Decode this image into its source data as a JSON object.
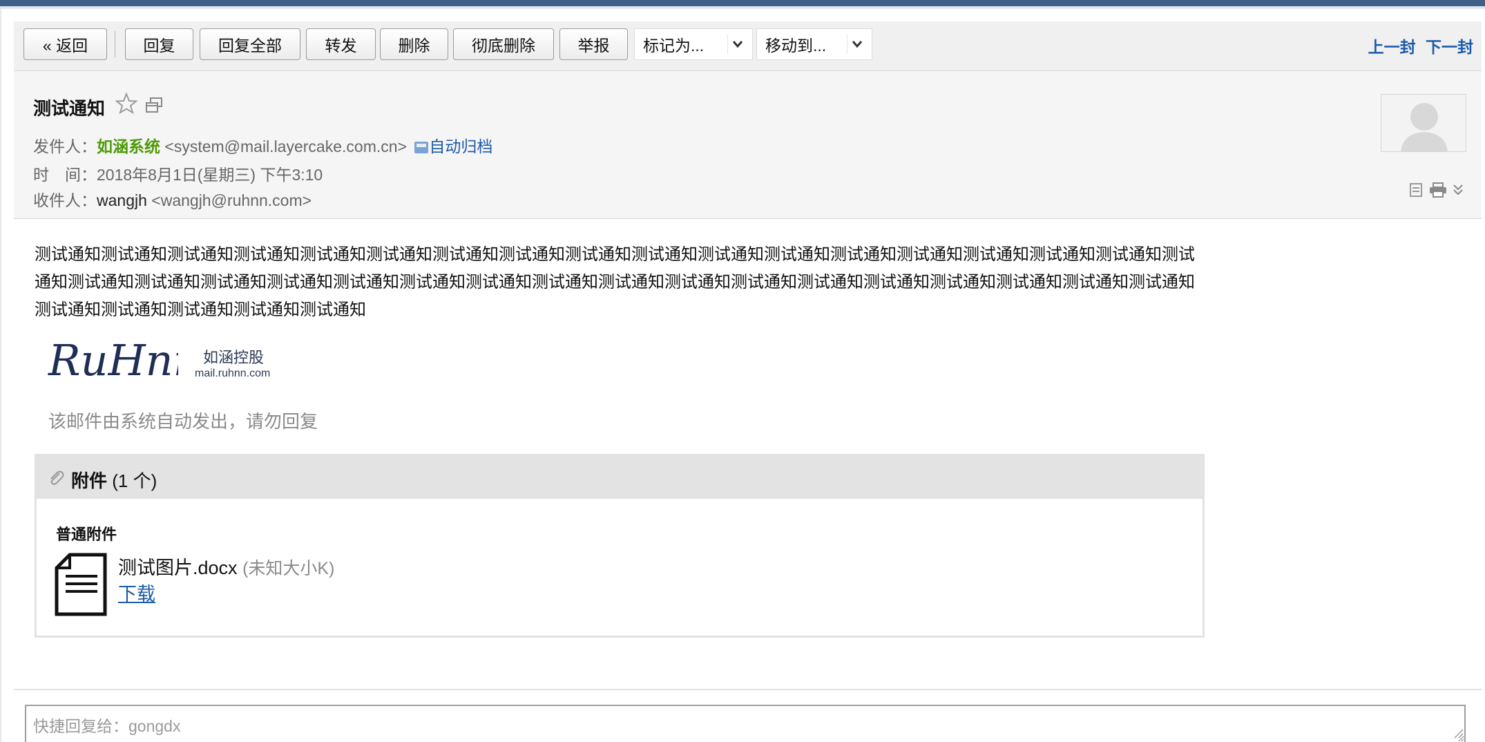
{
  "toolbar": {
    "back": "« 返回",
    "reply": "回复",
    "reply_all": "回复全部",
    "forward": "转发",
    "delete": "删除",
    "perm_delete": "彻底删除",
    "report": "举报",
    "mark_as": "标记为...",
    "move_to": "移动到...",
    "prev": "上一封",
    "next": "下一封"
  },
  "header": {
    "subject": "测试通知",
    "from_label": "发件人：",
    "from_name": "如涵系统",
    "from_email": "<system@mail.layercake.com.cn>",
    "archive": "自动归档",
    "time_label": "时　间：",
    "time_value": "2018年8月1日(星期三) 下午3:10",
    "to_label": "收件人：",
    "to_name": "wangjh",
    "to_email": "<wangjh@ruhnn.com>"
  },
  "body": {
    "text": "测试通知测试通知测试通知测试通知测试通知测试通知测试通知测试通知测试通知测试通知测试通知测试通知测试通知测试通知测试通知测试通知测试通知测试通知测试通知测试通知测试通知测试通知测试通知测试通知测试通知测试通知测试通知测试通知测试通知测试通知测试通知测试通知测试通知测试通知测试通知测试通知测试通知测试通知测试通知测试通知",
    "signature_logo": "RuHnn",
    "signature_company": "如涵控股",
    "signature_url": "mail.ruhnn.com",
    "notice": "该邮件由系统自动发出，请勿回复"
  },
  "attachments": {
    "title": "附件",
    "count": "(1 个)",
    "category": "普通附件",
    "items": [
      {
        "name": "测试图片.docx",
        "size": "(未知大小K)",
        "download": "下载"
      }
    ]
  },
  "quick_reply": {
    "placeholder": "快捷回复给：gongdx"
  },
  "colors": {
    "accent": "#1c5ba8",
    "sender": "#4e9a06",
    "topbar": "#3f5f86"
  }
}
